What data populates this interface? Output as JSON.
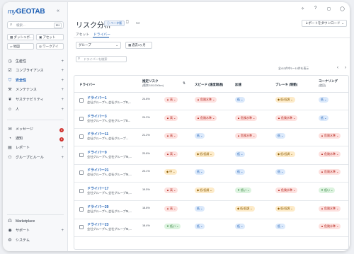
{
  "app": {
    "logo_prefix": "my",
    "logo_main": "GEOTAB",
    "collapse": "«"
  },
  "sidebar": {
    "search_placeholder": "検索...",
    "search_shortcut": "⌘K",
    "quick": [
      {
        "label": "ダッシュボ..."
      },
      {
        "label": "アセット"
      },
      {
        "label": "地図"
      },
      {
        "label": "ワークアイ"
      }
    ],
    "items": [
      {
        "label": "生産性",
        "icon": "clock-icon"
      },
      {
        "label": "コンプライアンス",
        "icon": "check-icon"
      },
      {
        "label": "安全性",
        "icon": "shield-icon"
      },
      {
        "label": "メンテナンス",
        "icon": "wrench-icon"
      },
      {
        "label": "サステナビリティ",
        "icon": "leaf-icon"
      },
      {
        "label": "人",
        "icon": "person-icon"
      }
    ],
    "items2": [
      {
        "label": "メッセージ",
        "badge": "3"
      },
      {
        "label": "通知",
        "badge": "6"
      },
      {
        "label": "レポート"
      },
      {
        "label": "グループとルール"
      }
    ],
    "bottom": [
      {
        "label": "Marketplace"
      },
      {
        "label": "サポート"
      },
      {
        "label": "システム"
      }
    ]
  },
  "header": {
    "title": "リスク分析",
    "beta": "ベータ版",
    "download": "レポートをダウンロード",
    "tabs": [
      {
        "label": "アセット"
      },
      {
        "label": "ドライバー"
      }
    ],
    "group_select": "グループ",
    "date_select": "過去1ヶ月",
    "driver_search_placeholder": "ドライバーを検索",
    "page_info": "全413件中1〜10件を表示"
  },
  "table": {
    "headers": {
      "driver": "ドライバー",
      "risk": "推定リスク",
      "risk_sub": "(衝突/100,000km)",
      "speed": "スピード (速度超過)",
      "accel": "加速",
      "brake": "ブレーキ (制動)",
      "corner": "コーナリング",
      "corner_sub": "(旋回)"
    },
    "rows": [
      {
        "name": "ドライバー1",
        "group": "会社グループA, 会社グループB,...",
        "score": "24.8%",
        "risk": "高",
        "speed": "危険水準",
        "accel": "低",
        "brake": "低/低調",
        "corner": "低"
      },
      {
        "name": "ドライバー3",
        "group": "会社グループA, 会社グループB...",
        "score": "24.2%",
        "risk": "高",
        "speed": "危険水準",
        "accel": "危険水準",
        "brake": "危険水準",
        "corner": "低"
      },
      {
        "name": "ドライバー11",
        "group": "会社グループA, 会社グループ...",
        "score": "21.2%",
        "risk": "高",
        "speed": "低",
        "accel": "危険水準",
        "brake": "低",
        "corner": "危険水準"
      },
      {
        "name": "ドライバー9",
        "group": "会社グループA, 会社グループM,...",
        "score": "20.8%",
        "risk": "高",
        "speed": "低/低調",
        "accel": "低",
        "brake": "低/低調",
        "corner": "危険水準"
      },
      {
        "name": "ドライバー21",
        "group": "会社グループA, 会社グループM,...",
        "score": "20.1%",
        "risk": "中",
        "speed": "低",
        "accel": "低",
        "brake": "低",
        "corner": "危険水準"
      },
      {
        "name": "ドライバー17",
        "group": "会社グループA, 会社グループM,...",
        "score": "19.5%",
        "risk": "高",
        "speed": "低/低調",
        "accel": "低い",
        "brake": "危険水準",
        "corner": "低い"
      },
      {
        "name": "ドライバー29",
        "group": "会社グループA, 会社グループM,...",
        "score": "18.8%",
        "risk": "高",
        "speed": "低",
        "accel": "低/低調",
        "brake": "低/低調",
        "corner": "危険水準"
      },
      {
        "name": "ドライバー23",
        "group": "会社グループA, 会社グループM,...",
        "score": "18.4%",
        "risk": "低い",
        "speed": "低",
        "accel": "低",
        "brake": "低",
        "corner": "危険水準"
      }
    ]
  }
}
